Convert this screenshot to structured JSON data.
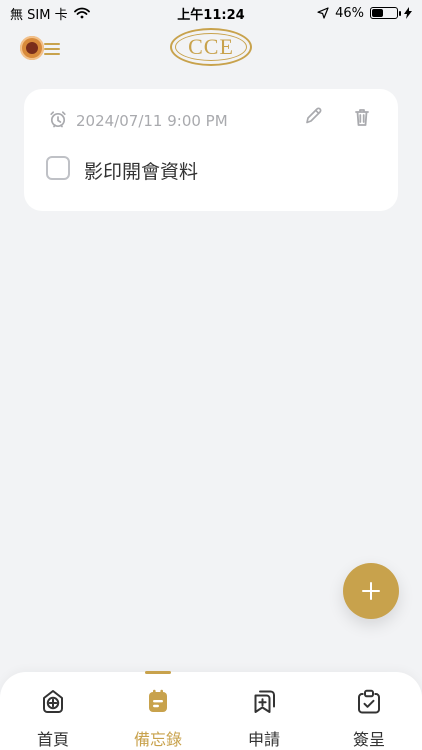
{
  "status_bar": {
    "carrier": "無 SIM 卡",
    "time": "上午11:24",
    "battery_percent": "46%",
    "battery_level": 0.46
  },
  "header": {
    "logo_text": "CCE"
  },
  "memo": {
    "datetime": "2024/07/11 9:00 PM",
    "task": "影印開會資料",
    "checked": false
  },
  "bottom_nav": {
    "items": [
      {
        "label": "首頁",
        "icon": "home-icon"
      },
      {
        "label": "備忘錄",
        "icon": "memo-icon",
        "active": true
      },
      {
        "label": "申請",
        "icon": "apply-icon"
      },
      {
        "label": "簽呈",
        "icon": "sign-icon"
      }
    ]
  },
  "colors": {
    "accent": "#c8a24c",
    "background": "#f2f3f5",
    "muted_text": "#a9aaae"
  }
}
